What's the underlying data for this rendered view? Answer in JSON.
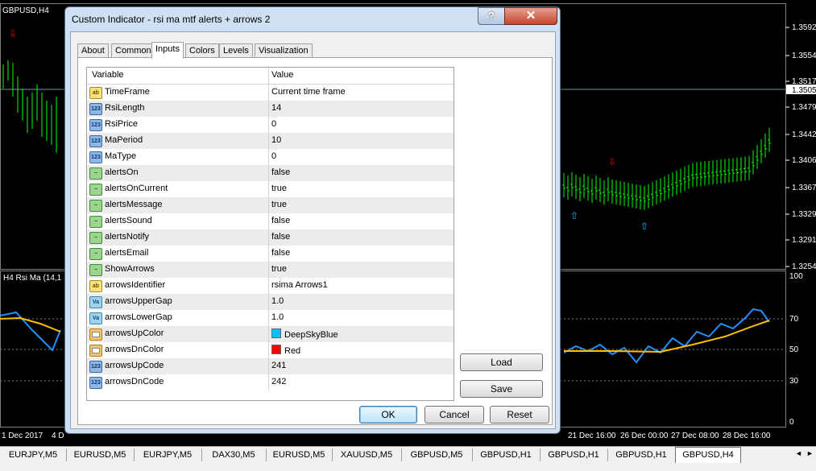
{
  "chart": {
    "symbol_label": "GBPUSD,H4",
    "indicator_label": "H4  Rsi Ma (14,1",
    "price_ticks": [
      "1.35925",
      "1.35546",
      "1.35170",
      "1.34796",
      "1.34425",
      "1.34060",
      "1.33676",
      "1.33296",
      "1.32916",
      "1.32546"
    ],
    "current_price": "1.35051",
    "rsi_ticks": [
      "100",
      "70",
      "50",
      "30",
      "0"
    ],
    "date_ticks": [
      "1 Dec 2017",
      "4 D",
      "21 Dec 16:00",
      "26 Dec 00:00",
      "27 Dec 08:00",
      "28 Dec 16:00"
    ]
  },
  "symbol_tabs": [
    {
      "label": "EURJPY,M5"
    },
    {
      "label": "EURUSD,M5"
    },
    {
      "label": "EURJPY,M5"
    },
    {
      "label": "DAX30,M5"
    },
    {
      "label": "EURUSD,M5"
    },
    {
      "label": "XAUUSD,M5"
    },
    {
      "label": "GBPUSD,M5"
    },
    {
      "label": "GBPUSD,H1"
    },
    {
      "label": "GBPUSD,H1"
    },
    {
      "label": "GBPUSD,H1"
    },
    {
      "label": "GBPUSD,H4"
    }
  ],
  "dialog": {
    "title": "Custom Indicator - rsi ma mtf alerts + arrows 2",
    "help_glyph": "?",
    "close_glyph": "✕",
    "tabs": [
      "About",
      "Common",
      "Inputs",
      "Colors",
      "Levels",
      "Visualization"
    ],
    "active_tab": "Inputs",
    "grid_headers": {
      "variable": "Variable",
      "value": "Value"
    },
    "inputs": [
      {
        "icon": "ab",
        "variable": "TimeFrame",
        "value": "Current time frame"
      },
      {
        "icon": "123",
        "variable": "RsiLength",
        "value": "14"
      },
      {
        "icon": "123",
        "variable": "RsiPrice",
        "value": "0"
      },
      {
        "icon": "123",
        "variable": "MaPeriod",
        "value": "10"
      },
      {
        "icon": "123",
        "variable": "MaType",
        "value": "0"
      },
      {
        "icon": "bool",
        "variable": "alertsOn",
        "value": "false"
      },
      {
        "icon": "bool",
        "variable": "alertsOnCurrent",
        "value": "true"
      },
      {
        "icon": "bool",
        "variable": "alertsMessage",
        "value": "true"
      },
      {
        "icon": "bool",
        "variable": "alertsSound",
        "value": "false"
      },
      {
        "icon": "bool",
        "variable": "alertsNotify",
        "value": "false"
      },
      {
        "icon": "bool",
        "variable": "alertsEmail",
        "value": "false"
      },
      {
        "icon": "bool",
        "variable": "ShowArrows",
        "value": "true"
      },
      {
        "icon": "ab",
        "variable": "arrowsIdentifier",
        "value": "rsima Arrows1"
      },
      {
        "icon": "vd",
        "variable": "arrowsUpperGap",
        "value": "1.0"
      },
      {
        "icon": "vd",
        "variable": "arrowsLowerGap",
        "value": "1.0"
      },
      {
        "icon": "color",
        "variable": "arrowsUpColor",
        "value": "DeepSkyBlue",
        "swatch": "#00bfff"
      },
      {
        "icon": "color",
        "variable": "arrowsDnColor",
        "value": "Red",
        "swatch": "#ff0000"
      },
      {
        "icon": "123",
        "variable": "arrowsUpCode",
        "value": "241"
      },
      {
        "icon": "123",
        "variable": "arrowsDnCode",
        "value": "242"
      }
    ],
    "buttons": {
      "load": "Load",
      "save": "Save",
      "ok": "OK",
      "cancel": "Cancel",
      "reset": "Reset"
    }
  },
  "colors": {
    "candle": "#00ff00",
    "rsi": "#1e90ff",
    "ma": "#ffc000",
    "up_arrow": "#00bfff",
    "dn_arrow": "#ff0000"
  }
}
